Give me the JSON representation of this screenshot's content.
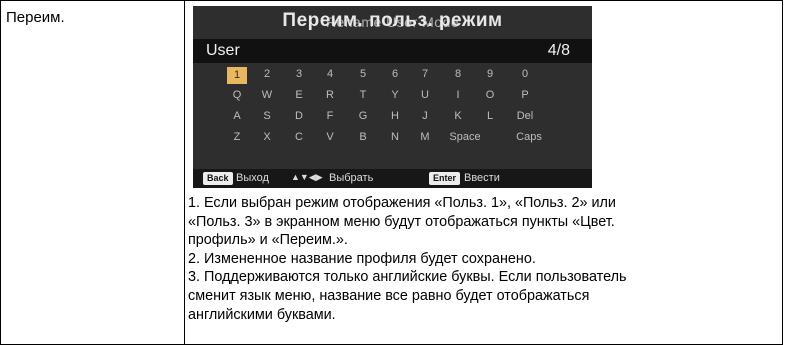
{
  "row_label": "Переим.",
  "osd": {
    "title": "Переим. польз. режим",
    "title_ghost": "Rename User Mode",
    "name": "User",
    "counter": "4/8",
    "keyboard": [
      [
        "1",
        "2",
        "3",
        "4",
        "5",
        "6",
        "7",
        "8",
        "9",
        "0"
      ],
      [
        "Q",
        "W",
        "E",
        "R",
        "T",
        "Y",
        "U",
        "I",
        "O",
        "P"
      ],
      [
        "A",
        "S",
        "D",
        "F",
        "G",
        "H",
        "J",
        "K",
        "L",
        "Del"
      ],
      [
        "Z",
        "X",
        "C",
        "V",
        "B",
        "N",
        "M",
        "Space",
        "Caps"
      ]
    ],
    "selected_key": "1",
    "footer": {
      "back_badge": "Back",
      "back_label": "Выход",
      "arrows": "▲▼◀▶",
      "select_label": "Выбрать",
      "enter_badge": "Enter",
      "enter_label": "Ввести"
    }
  },
  "notes": [
    "1. Если выбран режим отображения «Польз. 1», «Польз. 2» или",
    "«Польз. 3» в экранном меню будут отображаться пункты «Цвет.",
    "профиль» и «Переим.».",
    "2. Измененное название профиля будет сохранено.",
    "3. Поддерживаются только английские буквы. Если пользователь",
    "сменит язык меню, название все равно будет отображаться",
    "английскими буквами."
  ],
  "colors": {
    "osd_bg": "#2e2e2e",
    "selected_key": "#e8b760",
    "osd_text": "#e8e8e8"
  }
}
